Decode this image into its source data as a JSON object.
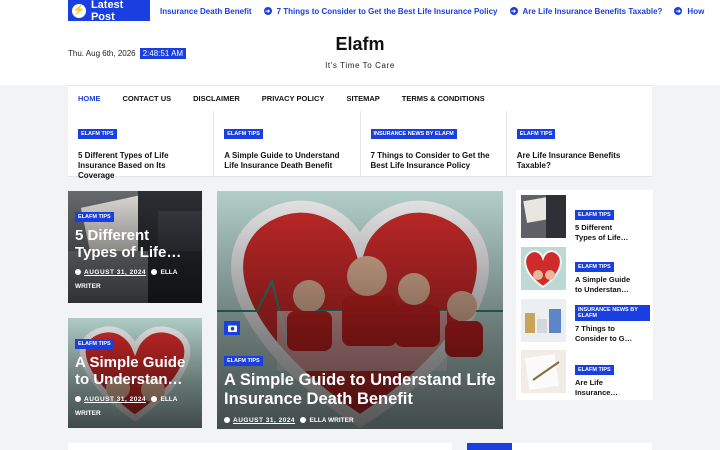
{
  "ticker": {
    "label": "Latest Post",
    "items": [
      "Insurance Death Benefit",
      "7 Things to Consider to Get the Best Life Insurance Policy",
      "Are Life Insurance Benefits Taxable?",
      "How"
    ]
  },
  "header": {
    "date": "Thu. Aug 6th, 2026",
    "time": "2:48:51 AM",
    "site_title": "Elafm",
    "tagline": "It's Time To Care"
  },
  "nav": {
    "items": [
      "HOME",
      "CONTACT US",
      "DISCLAIMER",
      "PRIVACY POLICY",
      "SITEMAP",
      "TERMS & CONDITIONS"
    ],
    "active": "HOME"
  },
  "featured": [
    {
      "badge": "ELAFM TIPS",
      "title": "5 Different Types of Life Insurance Based on Its Coverage"
    },
    {
      "badge": "ELAFM TIPS",
      "title": "A Simple Guide to Understand Life Insurance Death Benefit"
    },
    {
      "badge": "INSURANCE NEWS BY ELAFM",
      "title": "7 Things to Consider to Get the Best Life Insurance Policy"
    },
    {
      "badge": "ELAFM TIPS",
      "title": "Are Life Insurance Benefits Taxable?"
    }
  ],
  "cards": {
    "left_top": {
      "badge": "ELAFM TIPS",
      "title": "5 Different\nTypes of Life…",
      "date": "AUGUST 31, 2024",
      "author": "ELLA WRITER"
    },
    "left_bottom": {
      "badge": "ELAFM TIPS",
      "title": "A Simple Guide\nto Understan…",
      "date": "AUGUST 31, 2024",
      "author": "ELLA WRITER"
    },
    "main": {
      "badge": "ELAFM TIPS",
      "title": "A Simple Guide to Understand Life Insurance Death Benefit",
      "date": "AUGUST 31, 2024",
      "author": "ELLA WRITER"
    }
  },
  "sidebar": [
    {
      "badge": "ELAFM TIPS",
      "title": "5 Different\nTypes of Life…"
    },
    {
      "badge": "ELAFM TIPS",
      "title": "A Simple Guide\nto Understan…"
    },
    {
      "badge": "INSURANCE NEWS BY ELAFM",
      "title": "7 Things to\nConsider to G…"
    },
    {
      "badge": "ELAFM TIPS",
      "title": "Are Life\nInsurance…"
    }
  ],
  "colors": {
    "accent": "#1a3fe0",
    "background": "#f2f3f5"
  }
}
